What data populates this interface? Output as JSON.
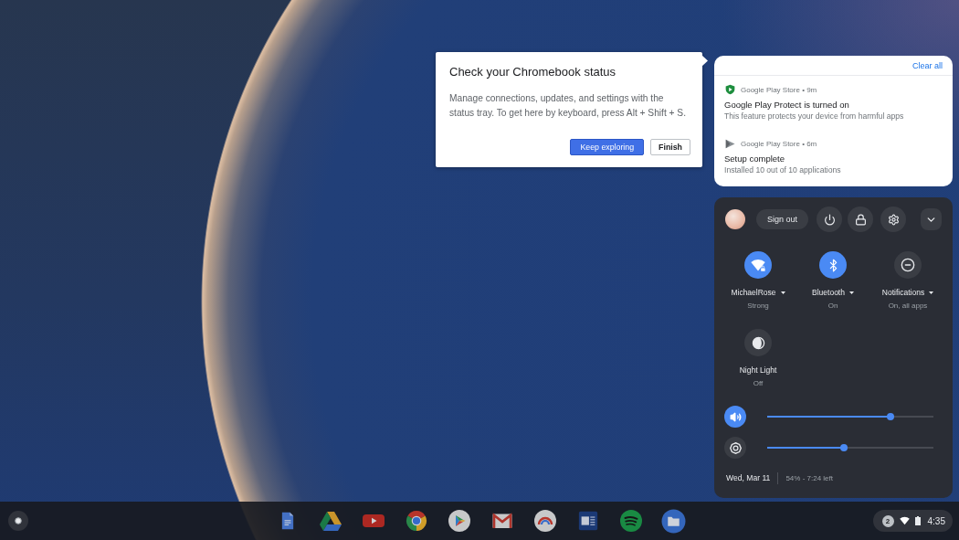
{
  "dialog": {
    "title": "Check your Chromebook status",
    "body": "Manage connections, updates, and settings with the status tray. To get here by keyboard, press Alt + Shift + S.",
    "buttons": [
      {
        "label": "Keep exploring",
        "primary": true
      },
      {
        "label": "Finish",
        "primary": false
      }
    ]
  },
  "notifications": {
    "clear_all": "Clear all",
    "items": [
      {
        "kind": "shield",
        "source": "Google Play Store • 9m",
        "title": "Google Play Protect is turned on",
        "body": "This feature protects your device from harmful apps"
      },
      {
        "kind": "store",
        "source": "Google Play Store • 6m",
        "title": "Setup complete",
        "body": "Installed 10 out of 10 applications"
      }
    ]
  },
  "quick_settings": {
    "sign_out": "Sign out",
    "tiles": [
      {
        "kind": "wifi",
        "label": "MichaelRose",
        "status": "Strong",
        "active": true,
        "has_menu": true
      },
      {
        "kind": "bluetooth",
        "label": "Bluetooth",
        "status": "On",
        "active": true,
        "has_menu": true
      },
      {
        "kind": "notifications",
        "label": "Notifications",
        "status": "On, all apps",
        "active": false,
        "has_menu": true
      },
      {
        "kind": "night_light",
        "label": "Night Light",
        "status": "Off",
        "active": false,
        "has_menu": false
      }
    ],
    "sliders": [
      {
        "kind": "volume",
        "active": true,
        "level": 0.74
      },
      {
        "kind": "brightness",
        "active": false,
        "level": 0.46
      }
    ],
    "date": "Wed, Mar 11",
    "battery": "54% - 7:24 left"
  },
  "shelf": {
    "apps": [
      {
        "kind": "document"
      },
      {
        "kind": "drive"
      },
      {
        "kind": "video"
      },
      {
        "kind": "browser"
      },
      {
        "kind": "store"
      },
      {
        "kind": "mail"
      },
      {
        "kind": "arc"
      },
      {
        "kind": "word"
      },
      {
        "kind": "music"
      },
      {
        "kind": "files"
      }
    ],
    "status": {
      "notification_count": "2",
      "time": "4:35"
    }
  }
}
